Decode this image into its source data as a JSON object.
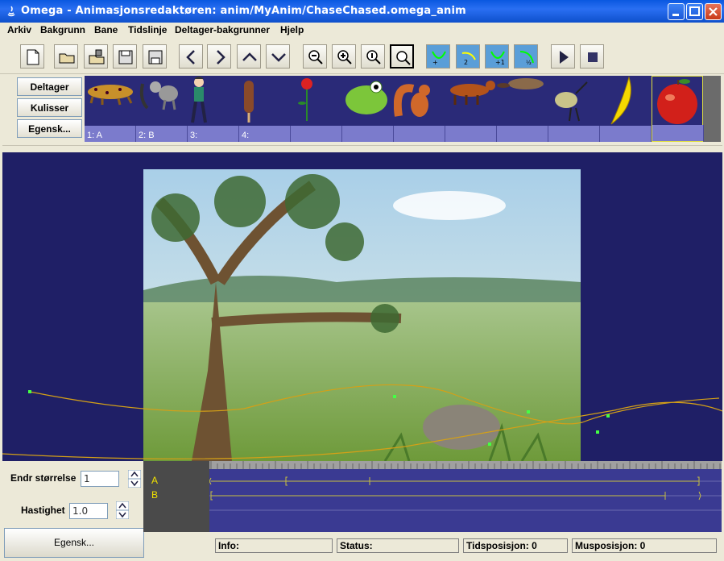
{
  "window": {
    "title": "Omega - Animasjonsredaktøren: anim/MyAnim/ChaseChased.omega_anim"
  },
  "menu": [
    "Arkiv",
    "Bakgrunn",
    "Bane",
    "Tidslinje",
    "Deltager-bakgrunner",
    "Hjelp"
  ],
  "toolbar": {
    "buttons": [
      "new-document-icon",
      "open-folder-icon",
      "open-file-icon",
      "save-icon",
      "save-as-icon",
      "previous-icon",
      "next-icon",
      "up-icon",
      "down-icon",
      "zoom-out-icon",
      "zoom-in-icon",
      "zoom-actual-icon",
      "zoom-fit-icon",
      "path-add-point-icon",
      "path-2-icon",
      "path-plus1-icon",
      "path-half-icon",
      "play-icon",
      "stop-icon"
    ]
  },
  "side_buttons": {
    "participant": "Deltager",
    "scenery": "Kulisser",
    "properties": "Egensk..."
  },
  "participants": [
    {
      "label": "1: A",
      "icon": "leopard-icon"
    },
    {
      "label": "2: B",
      "icon": "lemur-icon"
    },
    {
      "label": "3:",
      "icon": "boy-icon"
    },
    {
      "label": "4:",
      "icon": "ice-cream-icon"
    },
    {
      "label": "",
      "icon": "flower-icon"
    },
    {
      "label": "",
      "icon": "frog-icon"
    },
    {
      "label": "",
      "icon": "squirrel-icon"
    },
    {
      "label": "",
      "icon": "dog-icon"
    },
    {
      "label": "",
      "icon": "beaver-icon"
    },
    {
      "label": "",
      "icon": "bird-icon"
    },
    {
      "label": "",
      "icon": "banana-icon"
    },
    {
      "label": "",
      "icon": "apple-icon"
    }
  ],
  "controls": {
    "resize_label": "Endr størrelse",
    "resize_value": "1",
    "speed_label": "Hastighet",
    "speed_value": "1.0",
    "properties_button": "Egensk..."
  },
  "timeline": {
    "tracks": [
      "A",
      "B"
    ]
  },
  "status": {
    "info": "Info:",
    "status": "Status:",
    "time": "Tidsposisjon: 0",
    "mouse": "Musposisjon: 0"
  },
  "colors": {
    "title_bar": "#0a58e0",
    "stage": "#1f1f66",
    "participant_strip": "#2a2a78",
    "path": "#d4a017",
    "track_text": "#f0e000"
  }
}
